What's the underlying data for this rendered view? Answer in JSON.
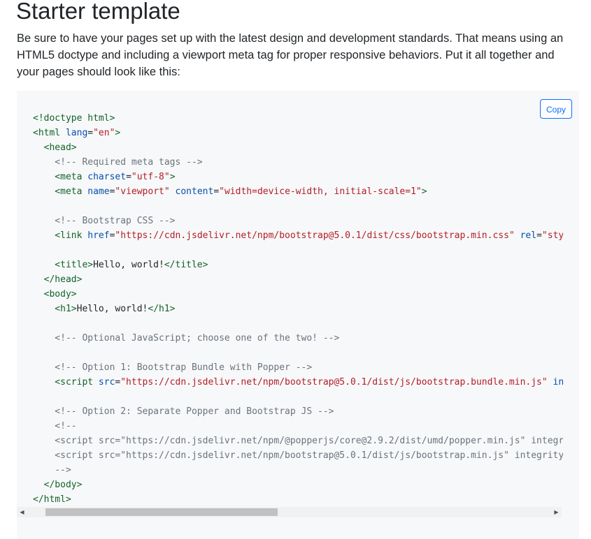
{
  "title": "Starter template",
  "lead": "Be sure to have your pages set up with the latest design and development standards. That means using an HTML5 doctype and including a viewport meta tag for proper responsive behaviors. Put it all together and your pages should look like this:",
  "copy_label": "Copy",
  "code": {
    "l1": "<!doctype html>",
    "l2a": "<html ",
    "l2b": "lang",
    "l2c": "=",
    "l2d": "\"en\"",
    "l2e": ">",
    "l3": "  <head>",
    "l4": "    <!-- Required meta tags -->",
    "l5a": "    <meta ",
    "l5b": "charset",
    "l5c": "=",
    "l5d": "\"utf-8\"",
    "l5e": ">",
    "l6a": "    <meta ",
    "l6b": "name",
    "l6c": "=",
    "l6d": "\"viewport\"",
    "l6e": " content",
    "l6f": "=",
    "l6g": "\"width=device-width, initial-scale=1\"",
    "l6h": ">",
    "l7": "",
    "l8": "    <!-- Bootstrap CSS -->",
    "l9a": "    <link ",
    "l9b": "href",
    "l9c": "=",
    "l9d": "\"https://cdn.jsdelivr.net/npm/bootstrap@5.0.1/dist/css/bootstrap.min.css\"",
    "l9e": " rel",
    "l9f": "=",
    "l9g": "\"styl",
    "l10": "",
    "l11a": "    <title>",
    "l11b": "Hello, world!",
    "l11c": "</title>",
    "l12": "  </head>",
    "l13": "  <body>",
    "l14a": "    <h1>",
    "l14b": "Hello, world!",
    "l14c": "</h1>",
    "l15": "",
    "l16": "    <!-- Optional JavaScript; choose one of the two! -->",
    "l17": "",
    "l18": "    <!-- Option 1: Bootstrap Bundle with Popper -->",
    "l19a": "    <script ",
    "l19b": "src",
    "l19c": "=",
    "l19d": "\"https://cdn.jsdelivr.net/npm/bootstrap@5.0.1/dist/js/bootstrap.bundle.min.js\"",
    "l19e": " int",
    "l20": "",
    "l21": "    <!-- Option 2: Separate Popper and Bootstrap JS -->",
    "l22": "    <!--",
    "l23": "    <script src=\"https://cdn.jsdelivr.net/npm/@popperjs/core@2.9.2/dist/umd/popper.min.js\" integri",
    "l24": "    <script src=\"https://cdn.jsdelivr.net/npm/bootstrap@5.0.1/dist/js/bootstrap.min.js\" integrity=",
    "l25": "    -->",
    "l26": "  </body>",
    "l27": "</html>"
  }
}
